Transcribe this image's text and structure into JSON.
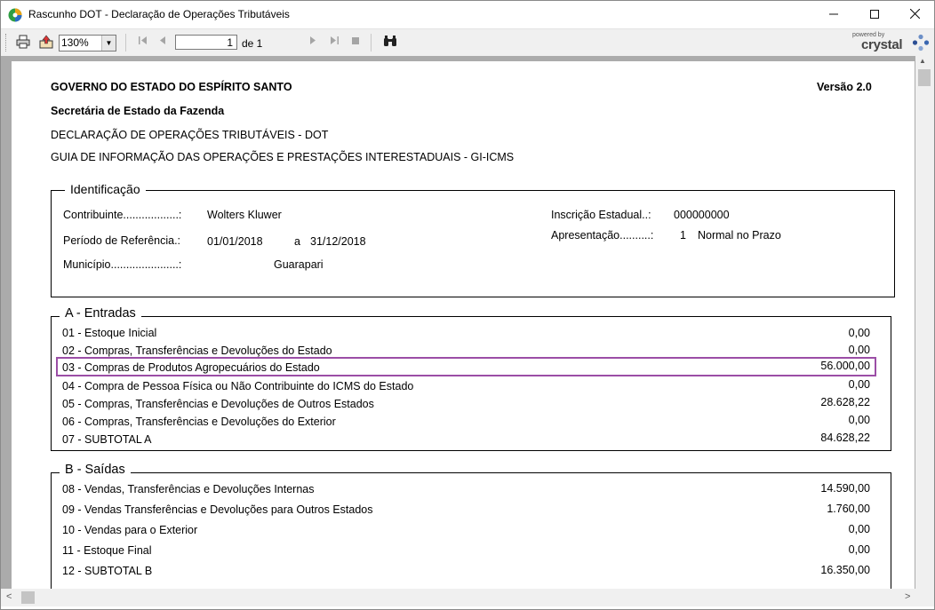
{
  "window": {
    "title": "Rascunho DOT - Declaração de Operações Tributáveis"
  },
  "toolbar": {
    "zoom": "130%",
    "page_current": "1",
    "page_of": "de 1",
    "powered_by": "powered by",
    "brand": "crystal"
  },
  "report": {
    "header": {
      "government": "GOVERNO DO ESTADO DO ESPÍRITO SANTO",
      "version": "Versão 2.0",
      "secretariat": "Secretária de Estado da Fazenda",
      "line1": "DECLARAÇÃO DE OPERAÇÕES TRIBUTÁVEIS - DOT",
      "line2": "GUIA DE INFORMAÇÃO DAS OPERAÇÕES E PRESTAÇÕES INTERESTADUAIS  - GI-ICMS"
    },
    "identificacao": {
      "legend": "Identificação",
      "contribuinte_label": "Contribuinte..................:",
      "contribuinte_value": "Wolters Kluwer",
      "periodo_label": "Período de Referência.:",
      "periodo_start": "01/01/2018",
      "periodo_sep": "a",
      "periodo_end": "31/12/2018",
      "municipio_label": "Município......................:",
      "municipio_value": "Guarapari",
      "inscricao_label": "Inscrição Estadual..:",
      "inscricao_value": "000000000",
      "apresentacao_label": "Apresentação..........:",
      "apresentacao_code": "1",
      "apresentacao_value": "Normal no Prazo"
    },
    "entradas": {
      "legend": "A - Entradas",
      "rows": [
        {
          "label": "01 - Estoque Inicial",
          "value": "0,00"
        },
        {
          "label": "02 - Compras, Transferências e Devoluções do Estado",
          "value": "0,00"
        },
        {
          "label": "03 - Compras de Produtos Agropecuários do Estado",
          "value": "56.000,00"
        },
        {
          "label": "04 - Compra de Pessoa Física ou Não Contribuinte do ICMS do Estado",
          "value": "0,00"
        },
        {
          "label": "05 - Compras, Transferências e Devoluções de Outros Estados",
          "value": "28.628,22"
        },
        {
          "label": "06 - Compras, Transferências e Devoluções do Exterior",
          "value": "0,00"
        },
        {
          "label": "07 - SUBTOTAL A",
          "value": "84.628,22"
        }
      ]
    },
    "saidas": {
      "legend": "B - Saídas",
      "rows": [
        {
          "label": "08 - Vendas, Transferências e Devoluções Internas",
          "value": "14.590,00"
        },
        {
          "label": "09 - Vendas Transferências e Devoluções para Outros Estados",
          "value": "1.760,00"
        },
        {
          "label": "10 - Vendas para o Exterior",
          "value": "0,00"
        },
        {
          "label": "11 - Estoque Final",
          "value": "0,00"
        },
        {
          "label": "12 - SUBTOTAL B",
          "value": "16.350,00"
        }
      ]
    }
  },
  "colors": {
    "highlight": "#9b4ea6"
  }
}
